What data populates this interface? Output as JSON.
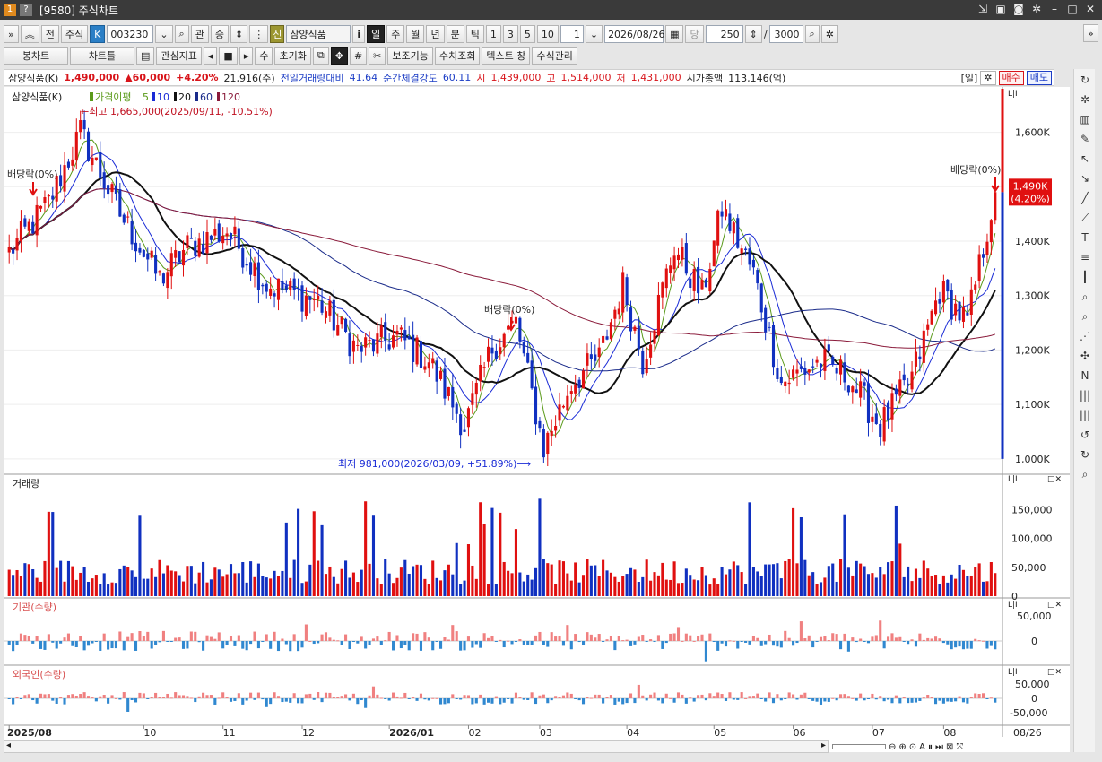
{
  "window": {
    "title": "[9580] 주식차트",
    "badges": [
      "1",
      "?"
    ],
    "controls": [
      "link-icon",
      "save-icon",
      "camera-icon",
      "gear-icon",
      "minimize-icon",
      "maximize-icon",
      "close-icon"
    ]
  },
  "toolbar1": {
    "market": "주식",
    "k_badge": "K",
    "code": "003230",
    "btn_gwan": "관",
    "btn_seung": "승",
    "sin_badge": "신",
    "stock_name": "삼양식품",
    "info_btn": "i",
    "periods": [
      "일",
      "주",
      "월",
      "년",
      "분",
      "틱"
    ],
    "active_period": "일",
    "intervals": [
      "1",
      "3",
      "5",
      "10"
    ],
    "interval_value": "1",
    "date": "2026/08/26",
    "dang": "당",
    "count": "250",
    "slash": "/",
    "max_count": "3000"
  },
  "toolbar2": {
    "bong_chart": "봉차트",
    "chart_type": "차트틀",
    "gwansim": "관심지표",
    "su": "수",
    "init": "초기화",
    "bojo": "보조기능",
    "suchi": "수치조회",
    "text_window": "텍스트 창",
    "formula": "수식관리"
  },
  "infobar": {
    "name": "삼양식품(K)",
    "price": "1,490,000",
    "change": "▲60,000",
    "change_pct": "+4.20%",
    "volume": "21,916(주)",
    "prev_vol_label": "전일거래량대비",
    "prev_vol": "41.64",
    "strength_label": "순간체결강도",
    "strength": "60.11",
    "open_label": "시",
    "open": "1,439,000",
    "high_label": "고",
    "high": "1,514,000",
    "low_label": "저",
    "low": "1,431,000",
    "mcap_label": "시가총액",
    "mcap": "113,146(억)",
    "period_btn": "[일]",
    "buy": "매수",
    "sell": "매도"
  },
  "chart_data": {
    "type": "candlestick",
    "main_legend": {
      "name": "삼양식품(K)",
      "ma_label": "가격이평",
      "ma_periods": [
        "5",
        "10",
        "20",
        "60",
        "120"
      ],
      "ma_colors": [
        "#5a9a1a",
        "#1a2bd6",
        "#111111",
        "#1a2b8a",
        "#8a1a3a"
      ]
    },
    "y_ticks": [
      "1,600K",
      "1,500K",
      "1,400K",
      "1,300K",
      "1,200K",
      "1,100K",
      "1,000K"
    ],
    "price_range": [
      975000,
      1680000
    ],
    "x_ticks": [
      "2025/08",
      "10",
      "11",
      "12",
      "2026/01",
      "02",
      "03",
      "04",
      "05",
      "06",
      "07",
      "08"
    ],
    "x_end_label": "08/26",
    "current_price_label": "1,490K",
    "current_pct_label": "(4.20%)",
    "annotations": {
      "max": "←최고 1,665,000(2025/09/11, -10.51%)",
      "min": "최저 981,000(2026/03/09, +51.89%)⟶",
      "dividend1": "배당락(0%)",
      "dividend2": "배당락(0%)",
      "dividend3": "배당락(0%)"
    },
    "panels": {
      "volume": {
        "title": "거래량",
        "ticks": [
          "150,000",
          "100,000",
          "50,000",
          "0"
        ],
        "max": 180000
      },
      "institution": {
        "title": "기관(수량)",
        "ticks": [
          "50,000",
          "0"
        ]
      },
      "foreign": {
        "title": "외국인(수량)",
        "ticks": [
          "50,000",
          "0",
          "-50,000"
        ]
      }
    },
    "candles": 250,
    "anchors_days": [
      0,
      10,
      18,
      28,
      38,
      45,
      55,
      65,
      78,
      88,
      98,
      106,
      115,
      122,
      128,
      135,
      142,
      149,
      155,
      160,
      168,
      175,
      180,
      188,
      195,
      205,
      212,
      220,
      228,
      235,
      242,
      249
    ],
    "anchors_close": [
      1380000,
      1470000,
      1600000,
      1450000,
      1330000,
      1390000,
      1420000,
      1320000,
      1290000,
      1200000,
      1225000,
      1180000,
      1060000,
      1205000,
      1250000,
      1020000,
      1140000,
      1185000,
      1320000,
      1180000,
      1390000,
      1300000,
      1460000,
      1340000,
      1140000,
      1180000,
      1150000,
      1060000,
      1150000,
      1310000,
      1250000,
      1490000
    ]
  }
}
